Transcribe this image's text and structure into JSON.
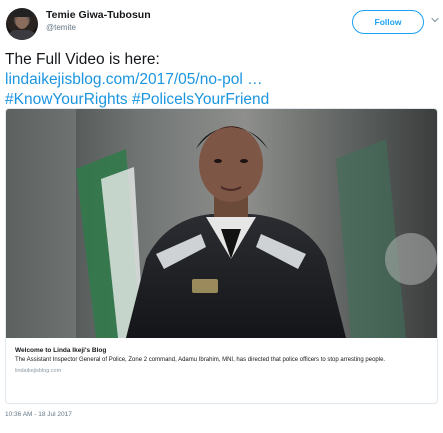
{
  "author": {
    "name": "Temie Giwa-Tubosun",
    "handle": "@temite"
  },
  "follow": {
    "label": "Follow"
  },
  "tweet": {
    "line1": "The Full Video is here:",
    "link": "lindaikejisblog.com/2017/05/no-pol",
    "ellipsis": " …",
    "hashtag1": "#KnowYourRights",
    "hashtag2": "#PolicelsYourFriend"
  },
  "card": {
    "title": "Welcome to Linda Ikeji's Blog",
    "description": "The Assistant Inspector General of Police, Zone 2 command, Adamu Ibrahim, MNI, has directed that police officers to stop arresting people.",
    "domain": "lindaikejisblog.com"
  },
  "timestamp": "10:36 AM - 18 Jul 2017",
  "icons": {
    "more": "chevron-down-icon"
  },
  "colors": {
    "link": "#1b95e0",
    "follow": "#1da1f2",
    "muted": "#657786"
  }
}
